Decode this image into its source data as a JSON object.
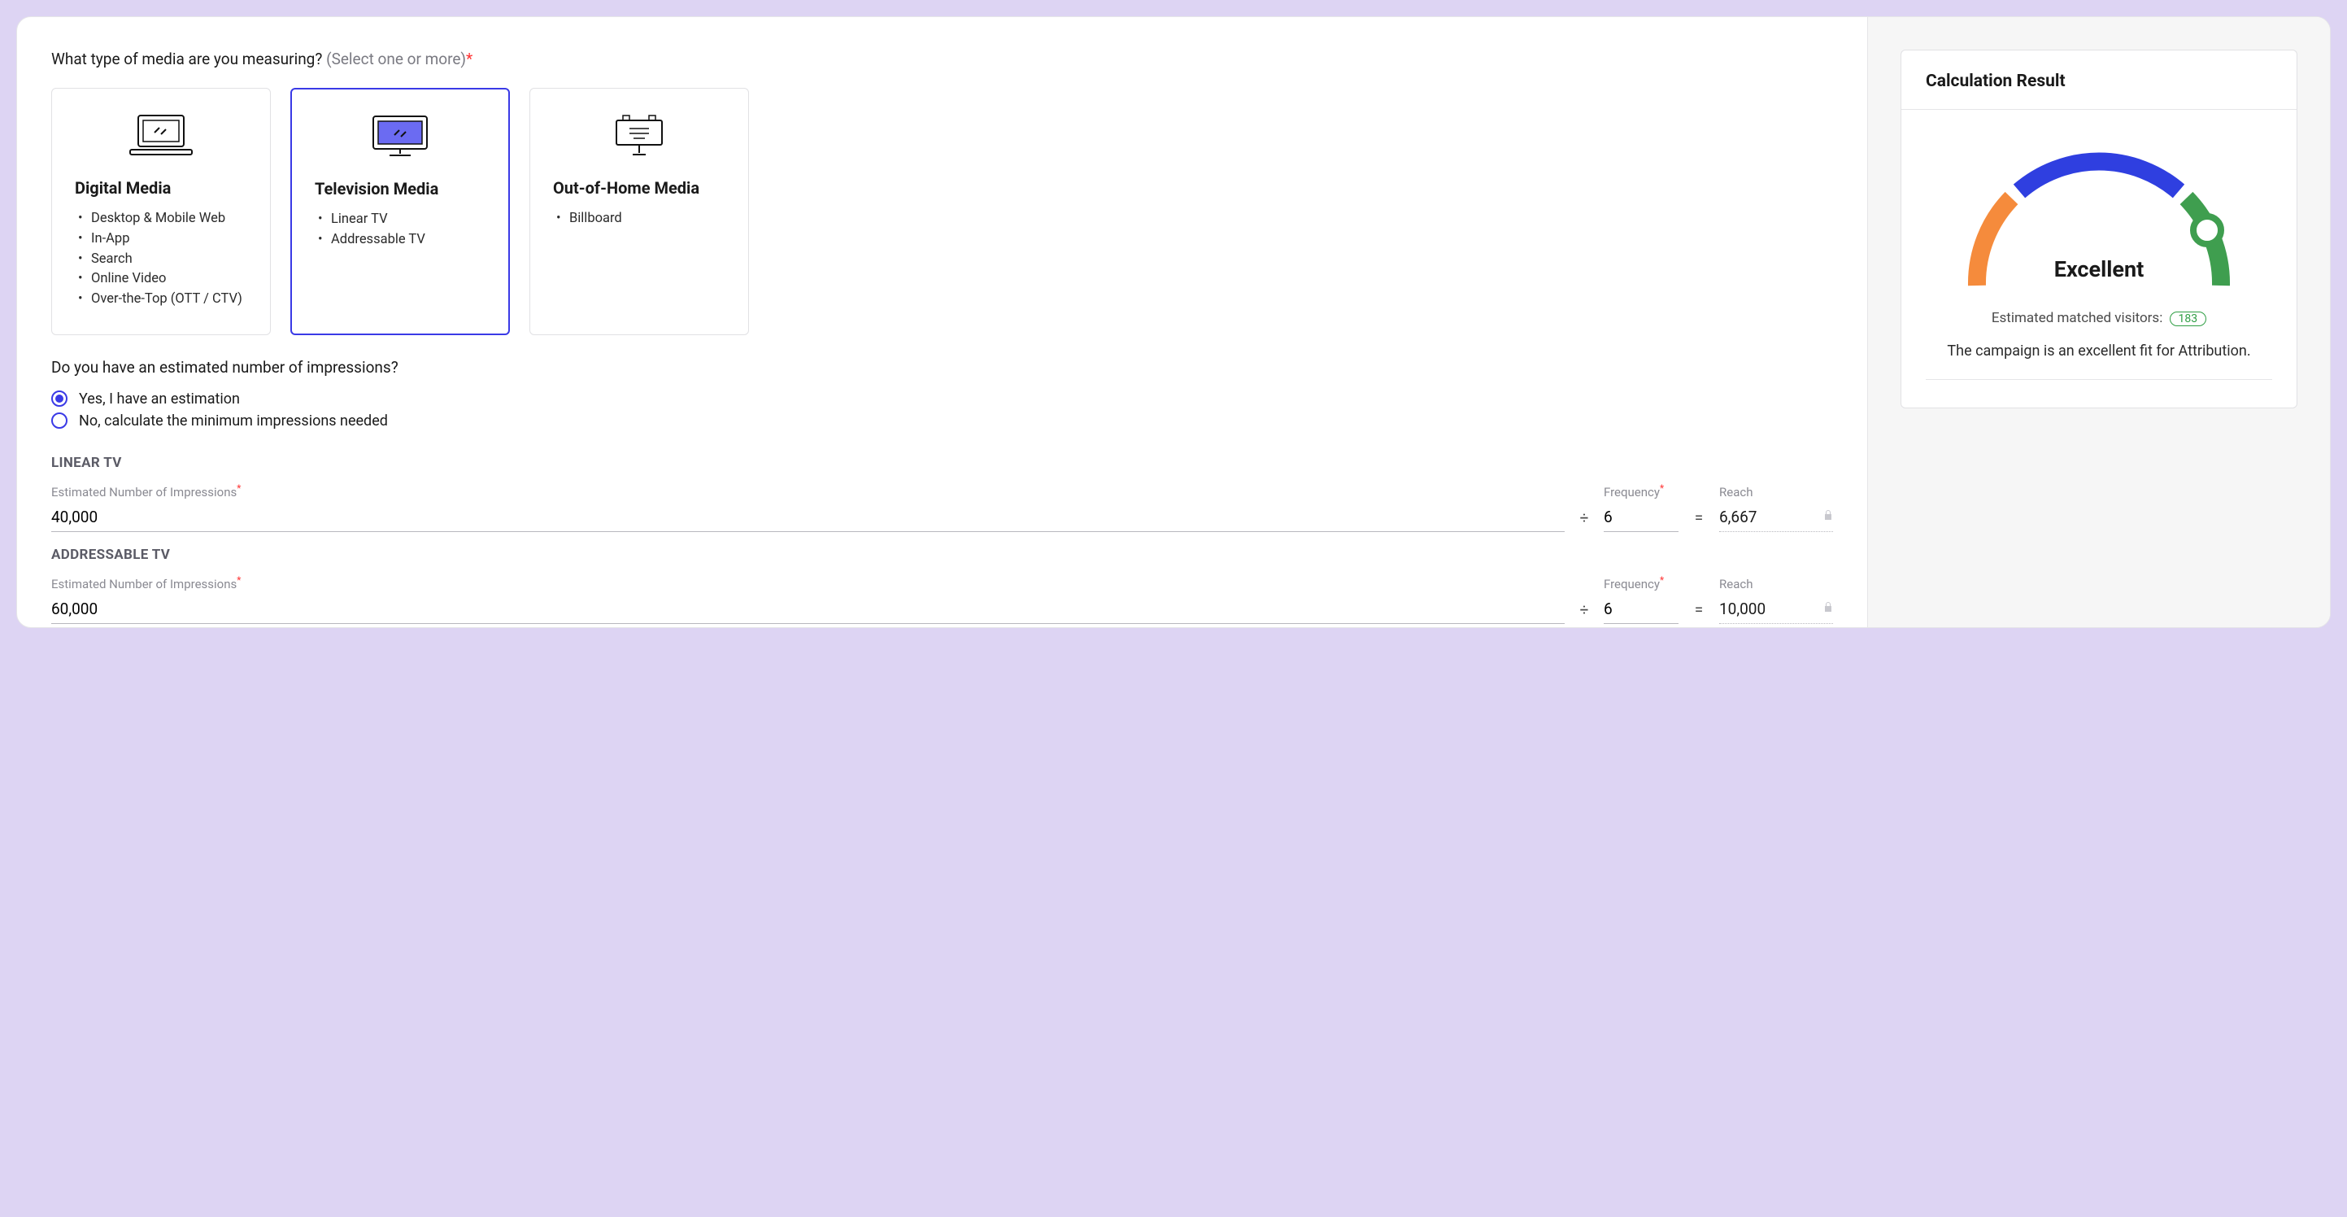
{
  "question1": {
    "prompt": "What type of media are you measuring?",
    "hint": "(Select one or more)"
  },
  "mediaCards": {
    "digital": {
      "title": "Digital Media",
      "items": [
        "Desktop & Mobile Web",
        "In-App",
        "Search",
        "Online Video",
        "Over-the-Top (OTT / CTV)"
      ],
      "selected": false
    },
    "tv": {
      "title": "Television Media",
      "items": [
        "Linear TV",
        "Addressable TV"
      ],
      "selected": true
    },
    "ooh": {
      "title": "Out-of-Home Media",
      "items": [
        "Billboard"
      ],
      "selected": false
    }
  },
  "question2": {
    "prompt": "Do you have an estimated number of impressions?",
    "opt_yes": "Yes, I have an estimation",
    "opt_no": "No, calculate the minimum impressions needed",
    "selected": "yes"
  },
  "fields": {
    "impressions_label": "Estimated Number of Impressions",
    "frequency_label": "Frequency",
    "reach_label": "Reach",
    "divide": "÷",
    "equals": "="
  },
  "sections": {
    "linear": {
      "heading": "LINEAR TV",
      "impressions": "40,000",
      "frequency": "6",
      "reach": "6,667"
    },
    "addressable": {
      "heading": "ADDRESSABLE TV",
      "impressions": "60,000",
      "frequency": "6",
      "reach": "10,000"
    }
  },
  "result": {
    "header": "Calculation Result",
    "rating": "Excellent",
    "est_label": "Estimated matched visitors:",
    "est_value": "183",
    "summary": "The campaign is an excellent fit for Attribution."
  }
}
